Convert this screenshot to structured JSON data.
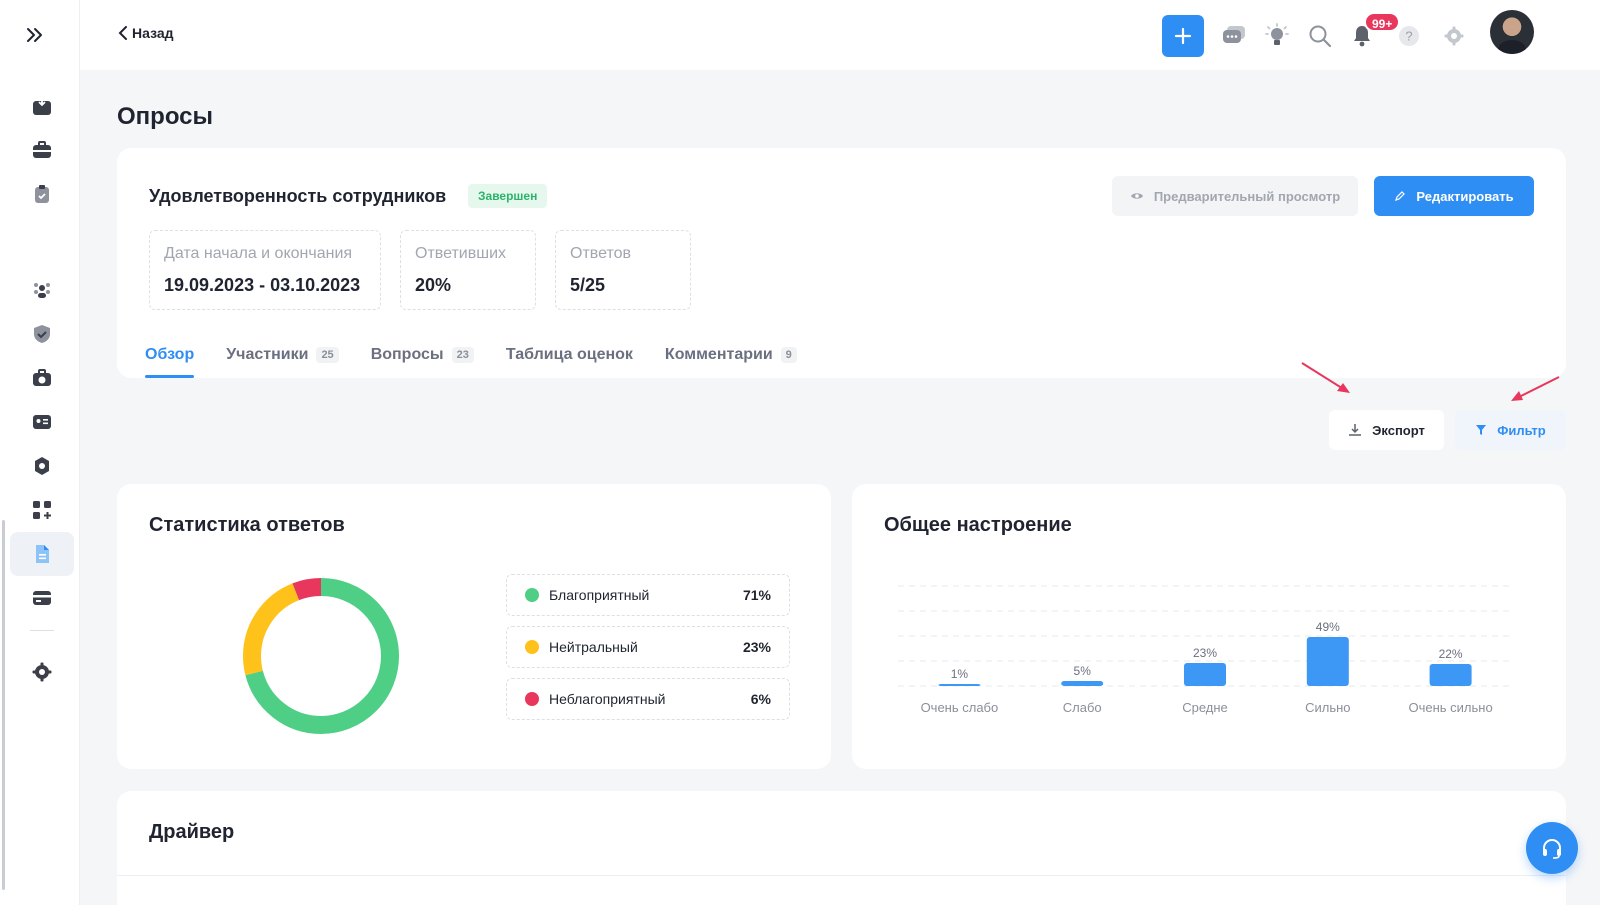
{
  "header": {
    "back_label": "Назад",
    "notifications_badge": "99+"
  },
  "page": {
    "title": "Опросы"
  },
  "survey": {
    "name": "Удовлетворенность сотрудников",
    "status": "Завершен",
    "preview_label": "Предварительный просмотр",
    "edit_label": "Редактировать",
    "stats": [
      {
        "label": "Дата начала и окончания",
        "value": "19.09.2023 - 03.10.2023"
      },
      {
        "label": "Ответивших",
        "value": "20%"
      },
      {
        "label": "Ответов",
        "value": "5/25"
      }
    ],
    "tabs": [
      {
        "label": "Обзор",
        "count": null,
        "active": true
      },
      {
        "label": "Участники",
        "count": "25",
        "active": false
      },
      {
        "label": "Вопросы",
        "count": "23",
        "active": false
      },
      {
        "label": "Таблица оценок",
        "count": null,
        "active": false
      },
      {
        "label": "Комментарии",
        "count": "9",
        "active": false
      }
    ]
  },
  "actions": {
    "export_label": "Экспорт",
    "filter_label": "Фильтр"
  },
  "response_stats": {
    "title": "Статистика ответов",
    "legend": [
      {
        "label": "Благоприятный",
        "pct": "71%",
        "color": "#4fcf85"
      },
      {
        "label": "Нейтральный",
        "pct": "23%",
        "color": "#ffc21a"
      },
      {
        "label": "Неблагоприятный",
        "pct": "6%",
        "color": "#e8365d"
      }
    ]
  },
  "mood": {
    "title": "Общее настроение"
  },
  "driver": {
    "title": "Драйвер"
  },
  "chart_data": [
    {
      "type": "pie",
      "title": "Статистика ответов",
      "categories": [
        "Благоприятный",
        "Нейтральный",
        "Неблагоприятный"
      ],
      "values": [
        71,
        23,
        6
      ],
      "colors": [
        "#4fcf85",
        "#ffc21a",
        "#e8365d"
      ],
      "legend": "right"
    },
    {
      "type": "bar",
      "title": "Общее настроение",
      "categories": [
        "Очень слабо",
        "Слабо",
        "Средне",
        "Сильно",
        "Очень сильно"
      ],
      "values": [
        1,
        5,
        23,
        49,
        22
      ],
      "labels": [
        "1%",
        "5%",
        "23%",
        "49%",
        "22%"
      ],
      "color": "#3d98f5",
      "ylim": [
        0,
        100
      ],
      "grid": true
    }
  ]
}
